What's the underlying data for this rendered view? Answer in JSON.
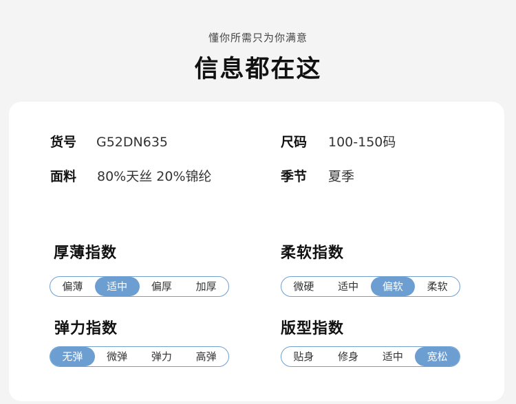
{
  "header": {
    "subtitle": "懂你所需只为你满意",
    "title": "信息都在这"
  },
  "specs": [
    {
      "label": "货号",
      "value": "G52DN635"
    },
    {
      "label": "尺码",
      "value": "100-150码"
    },
    {
      "label": "面料",
      "value": "80%天丝 20%锦纶"
    },
    {
      "label": "季节",
      "value": "夏季"
    }
  ],
  "indices": [
    {
      "title": "厚薄指数",
      "options": [
        "偏薄",
        "适中",
        "偏厚",
        "加厚"
      ],
      "selected": "适中"
    },
    {
      "title": "柔软指数",
      "options": [
        "微硬",
        "适中",
        "偏软",
        "柔软"
      ],
      "selected": "偏软"
    },
    {
      "title": "弹力指数",
      "options": [
        "无弹",
        "微弹",
        "弹力",
        "高弹"
      ],
      "selected": "无弹"
    },
    {
      "title": "版型指数",
      "options": [
        "贴身",
        "修身",
        "适中",
        "宽松"
      ],
      "selected": "宽松"
    }
  ],
  "colors": {
    "accent": "#6c9ed2",
    "border": "#6f9fcf"
  }
}
